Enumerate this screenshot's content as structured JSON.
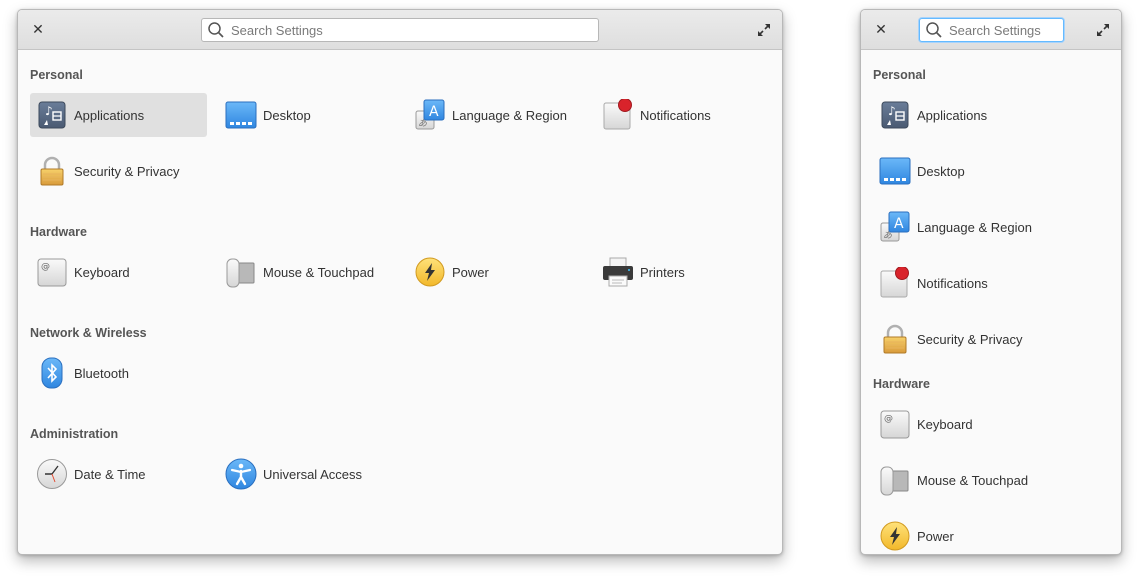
{
  "windows": [
    {
      "search": {
        "placeholder": "Search Settings",
        "value": ""
      },
      "sections": [
        {
          "title": "Personal",
          "items": [
            {
              "label": "Applications",
              "icon": "applications-icon",
              "selected": true
            },
            {
              "label": "Desktop",
              "icon": "desktop-icon"
            },
            {
              "label": "Language & Region",
              "icon": "language-icon"
            },
            {
              "label": "Notifications",
              "icon": "notifications-icon"
            },
            {
              "label": "Security & Privacy",
              "icon": "lock-icon"
            }
          ]
        },
        {
          "title": "Hardware",
          "items": [
            {
              "label": "Keyboard",
              "icon": "keyboard-icon"
            },
            {
              "label": "Mouse & Touchpad",
              "icon": "mouse-icon"
            },
            {
              "label": "Power",
              "icon": "power-icon"
            },
            {
              "label": "Printers",
              "icon": "printer-icon"
            }
          ]
        },
        {
          "title": "Network & Wireless",
          "items": [
            {
              "label": "Bluetooth",
              "icon": "bluetooth-icon"
            }
          ]
        },
        {
          "title": "Administration",
          "items": [
            {
              "label": "Date & Time",
              "icon": "clock-icon"
            },
            {
              "label": "Universal Access",
              "icon": "accessibility-icon"
            }
          ]
        }
      ]
    },
    {
      "search": {
        "placeholder": "Search Settings",
        "value": "",
        "focused": true
      },
      "sections": [
        {
          "title": "Personal",
          "items": [
            {
              "label": "Applications",
              "icon": "applications-icon"
            },
            {
              "label": "Desktop",
              "icon": "desktop-icon"
            },
            {
              "label": "Language & Region",
              "icon": "language-icon"
            },
            {
              "label": "Notifications",
              "icon": "notifications-icon"
            },
            {
              "label": "Security & Privacy",
              "icon": "lock-icon"
            }
          ]
        },
        {
          "title": "Hardware",
          "items": [
            {
              "label": "Keyboard",
              "icon": "keyboard-icon"
            },
            {
              "label": "Mouse & Touchpad",
              "icon": "mouse-icon"
            },
            {
              "label": "Power",
              "icon": "power-icon"
            }
          ]
        }
      ]
    }
  ],
  "common": {
    "close_glyph": "✕"
  }
}
